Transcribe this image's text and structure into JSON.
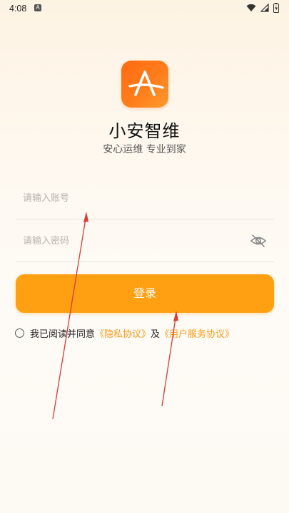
{
  "status_bar": {
    "time": "4:08",
    "notification_letter": "A"
  },
  "app": {
    "logo_letter": "A",
    "name": "小安智维",
    "slogan": "安心运维 专业到家"
  },
  "form": {
    "account_placeholder": "请输入账号",
    "account_value": "",
    "password_placeholder": "请输入密码",
    "password_value": "",
    "login_label": "登录"
  },
  "agreement": {
    "prefix": "我已阅读并同意",
    "privacy_link": "《隐私协议》",
    "conjunction": "及",
    "user_service_link": "《用户服务协议》",
    "checked": false
  },
  "colors": {
    "accent": "#ff9f12",
    "logo_gradient_start": "#ff6a13",
    "link": "#ff9a16",
    "annotation_arrow": "#d93b36"
  },
  "icons": {
    "logo": "app-logo-icon",
    "password_toggle": "eye-off-icon",
    "wifi": "wifi-icon",
    "signal": "signal-icon",
    "battery": "battery-icon"
  }
}
